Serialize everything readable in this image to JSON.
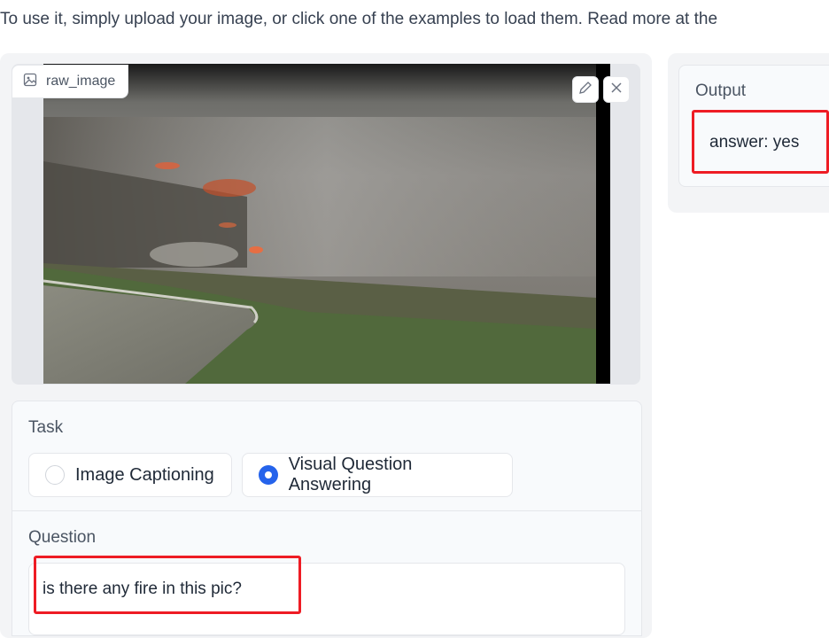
{
  "intro_text": "To use it, simply upload your image, or click one of the examples to load them. Read more at the",
  "image_input": {
    "label": "raw_image",
    "icons": [
      "image-icon",
      "pencil-icon",
      "close-icon"
    ]
  },
  "task": {
    "label": "Task",
    "options": [
      {
        "label": "Image Captioning",
        "selected": false
      },
      {
        "label": "Visual Question Answering",
        "selected": true
      }
    ]
  },
  "question": {
    "label": "Question",
    "value": "is there any fire in this pic?"
  },
  "output": {
    "label": "Output",
    "value": "answer: yes"
  },
  "colors": {
    "accent": "#2563eb",
    "highlight": "#ee1c24",
    "panel": "#f3f4f6"
  }
}
